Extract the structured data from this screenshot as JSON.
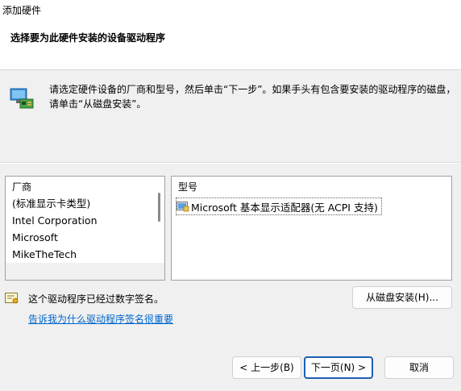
{
  "window": {
    "title": "添加硬件"
  },
  "header": {
    "heading": "选择要为此硬件安装的设备驱动程序"
  },
  "instruction": {
    "line1": "请选定硬件设备的厂商和型号，然后单击“下一步”。如果手头有包含要安装的驱动程序的磁盘，",
    "line2": "请单击“从磁盘安装”。"
  },
  "manufacturer_list": {
    "header": "厂商",
    "items": [
      "(标准显示卡类型)",
      "Intel Corporation",
      "Microsoft",
      "MikeTheTech"
    ]
  },
  "model_list": {
    "header": "型号",
    "items": [
      "Microsoft 基本显示适配器(无 ACPI 支持)"
    ]
  },
  "signature": {
    "text": "这个驱动程序已经过数字签名。",
    "link": "告诉我为什么驱动程序签名很重要"
  },
  "buttons": {
    "have_disk": "从磁盘安装(H)...",
    "back": "< 上一步(B)",
    "next": "下一页(N) >",
    "cancel": "取消"
  },
  "icons": {
    "hardware": "hardware-device-icon",
    "signature": "certificate-icon",
    "model_item": "display-adapter-icon"
  },
  "colors": {
    "link": "#0066cc",
    "default_button_border": "#1e5fb4"
  }
}
